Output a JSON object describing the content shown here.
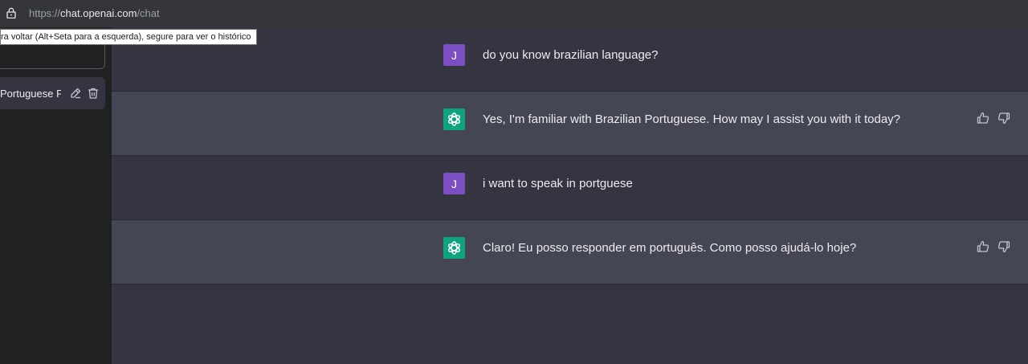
{
  "browser": {
    "url_prefix": "https://",
    "url_domain": "chat.openai.com",
    "url_path": "/chat",
    "back_tooltip": "ra voltar (Alt+Seta para a esquerda), segure para ver o histórico"
  },
  "sidebar": {
    "conversation_title": "Portuguese Fa"
  },
  "messages": [
    {
      "role": "user",
      "avatar_letter": "J",
      "text": "do you know brazilian language?"
    },
    {
      "role": "assistant",
      "text": "Yes, I'm familiar with Brazilian Portuguese. How may I assist you with it today?"
    },
    {
      "role": "user",
      "avatar_letter": "J",
      "text": "i want to speak in portguese"
    },
    {
      "role": "assistant",
      "text": "Claro! Eu posso responder em português. Como posso ajudá-lo hoje?"
    }
  ],
  "icons": {
    "lock": "lock-icon",
    "edit": "pencil-icon",
    "delete": "trash-icon",
    "bot_avatar": "openai-logo-icon",
    "like": "thumbs-up-icon",
    "dislike": "thumbs-down-icon"
  },
  "colors": {
    "chat_bg": "#343541",
    "assistant_row_bg": "#444654",
    "sidebar_bg": "#202123",
    "user_avatar": "#7b4fc2",
    "bot_avatar": "#10a37f"
  }
}
